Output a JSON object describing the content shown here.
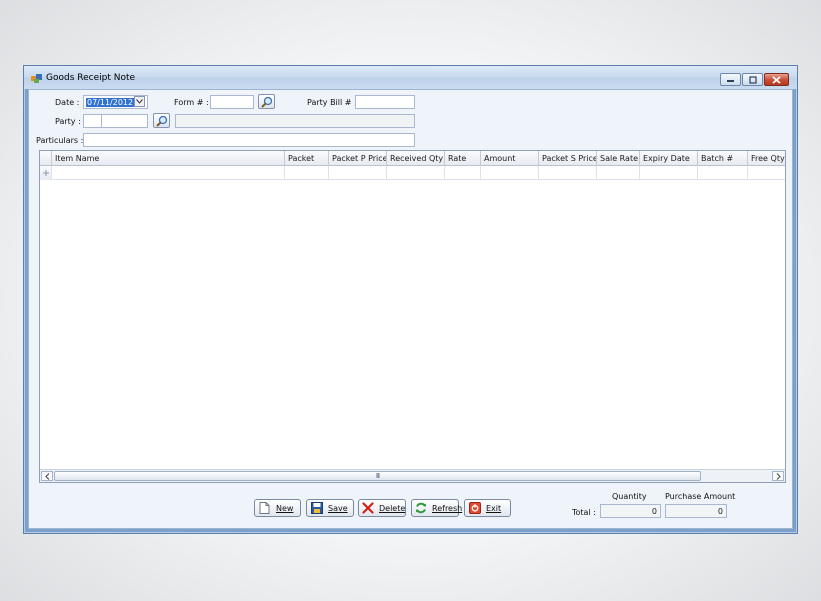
{
  "window": {
    "title": "Goods Receipt Note"
  },
  "form": {
    "date_label": "Date :",
    "date_value": "07/11/2012",
    "form_label": "Form # :",
    "form_value": "",
    "party_bill_label": "Party Bill # :",
    "party_bill_value": "",
    "party_label": "Party :",
    "party_code_a": "",
    "party_code_b": "",
    "party_name": "",
    "particulars_label": "Particulars :",
    "particulars_value": ""
  },
  "grid": {
    "columns": [
      "Item Name",
      "Packet",
      "Packet P Price",
      "Received Qty",
      "Rate",
      "Amount",
      "Packet S Price",
      "Sale Rate",
      "Expiry Date",
      "Batch #",
      "Free Qty"
    ],
    "scroll_grip": "III"
  },
  "buttons": {
    "new": "New",
    "save": "Save",
    "delete": "Delete",
    "refresh": "Refresh",
    "exit": "Exit"
  },
  "totals": {
    "label": "Total :",
    "quantity_header": "Quantity",
    "amount_header": "Purchase Amount",
    "quantity_value": "0",
    "amount_value": "0"
  },
  "icons": {
    "app": "app-icon",
    "lookup": "magnifier-icon",
    "new": "new-document-icon",
    "save": "save-disk-icon",
    "delete": "delete-x-icon",
    "refresh": "refresh-icon",
    "exit": "exit-icon"
  }
}
